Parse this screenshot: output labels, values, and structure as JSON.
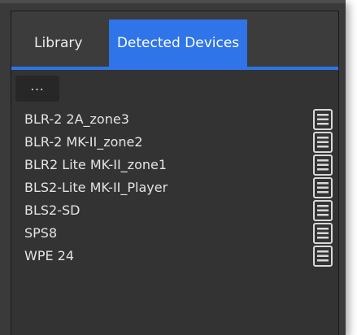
{
  "tabs": [
    {
      "label": "Library",
      "active": false
    },
    {
      "label": "Detected Devices",
      "active": true
    }
  ],
  "toolbar": {
    "more_label": "..."
  },
  "devices": [
    {
      "name": "BLR-2 2A_zone3",
      "icon": "list-icon"
    },
    {
      "name": "BLR-2 MK-II_zone2",
      "icon": "list-icon"
    },
    {
      "name": "BLR2 Lite MK-II_zone1",
      "icon": "list-icon"
    },
    {
      "name": "BLS2-Lite MK-II_Player",
      "icon": "list-icon"
    },
    {
      "name": "BLS2-SD",
      "icon": "list-icon"
    },
    {
      "name": "SPS8",
      "icon": "list-icon"
    },
    {
      "name": "WPE 24",
      "icon": "list-icon"
    }
  ],
  "colors": {
    "accent": "#2f74e8",
    "panel_bg": "#333333",
    "tab_bg": "#3c3c3c",
    "text": "#e4e4e4"
  }
}
